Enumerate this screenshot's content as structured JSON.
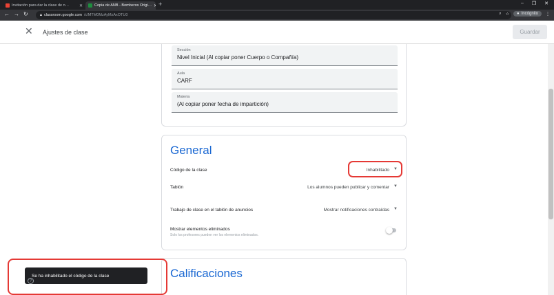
{
  "browser": {
    "tabs": [
      {
        "title": "Invitación para dar la clase de n…",
        "active": false
      },
      {
        "title": "Copia de ANB - Bomberos Origi…",
        "active": true
      }
    ],
    "url_host": "classroom.google.com",
    "url_path": "/c/MTM0MzAyMzAxOTU0",
    "incognito_label": "Incógnito"
  },
  "appbar": {
    "title": "Ajustes de clase",
    "save_label": "Guardar"
  },
  "fields": [
    {
      "label": "Sección",
      "value": "Nivel Inicial (Al copiar poner Cuerpo o Compañía)"
    },
    {
      "label": "Aula",
      "value": "CARF"
    },
    {
      "label": "Materia",
      "value": "(Al copiar poner fecha de impartición)"
    }
  ],
  "general": {
    "heading": "General",
    "rows": [
      {
        "label": "Código de la clase",
        "value": "Inhabilitado"
      },
      {
        "label": "Tablón",
        "value": "Los alumnos pueden publicar y comentar"
      },
      {
        "label": "Trabajo de clase en el tablón de anuncios",
        "value": "Mostrar notificaciones contraídas"
      }
    ],
    "toggle_row": {
      "label": "Mostrar elementos eliminados",
      "sublabel": "Solo los profesores pueden ver los elementos eliminados.",
      "enabled": false
    }
  },
  "grades": {
    "heading": "Calificaciones"
  },
  "snackbar": {
    "message": "Se ha inhabilitado el código de la clase"
  },
  "colors": {
    "accent": "#1967d2",
    "highlight": "#e53935"
  }
}
